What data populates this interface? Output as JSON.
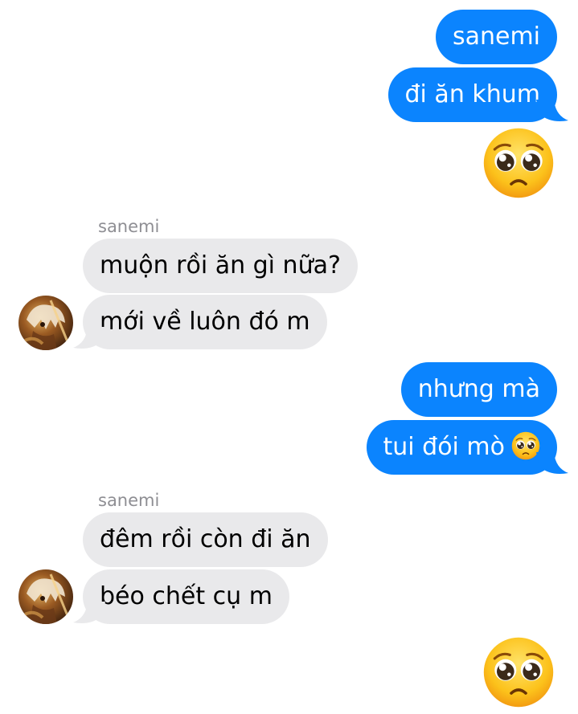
{
  "conversation": {
    "messages": [
      {
        "sender": "me",
        "text": "sanemi"
      },
      {
        "sender": "me",
        "text": "đi ăn khum"
      },
      {
        "sender": "me",
        "emoji": "pleading-face"
      },
      {
        "sender_name": "sanemi"
      },
      {
        "sender": "sanemi",
        "text": "muộn rồi ăn gì nữa?"
      },
      {
        "sender": "sanemi",
        "text": "mới về luôn đó m"
      },
      {
        "sender": "me",
        "text": "nhưng mà"
      },
      {
        "sender": "me",
        "text": "tui đói mò",
        "emoji": "pleading-face"
      },
      {
        "sender_name": "sanemi"
      },
      {
        "sender": "sanemi",
        "text": "đêm rồi còn đi ăn"
      },
      {
        "sender": "sanemi",
        "text": "béo chết cụ m"
      },
      {
        "sender": "me",
        "emoji": "pleading-face"
      }
    ]
  },
  "colors": {
    "sent_bubble": "#0b84fe",
    "received_bubble": "#e9e9eb",
    "sender_name": "#8e8e93"
  },
  "icons": {
    "emoji": "pleading-face",
    "avatar": "sanemi-avatar"
  }
}
